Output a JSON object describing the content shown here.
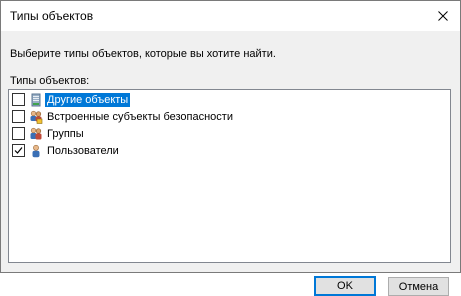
{
  "window": {
    "title": "Типы объектов",
    "close_icon": "close-icon"
  },
  "instruction": "Выберите типы объектов, которые вы хотите найти.",
  "list_label": "Типы объектов:",
  "object_types": [
    {
      "label": "Другие объекты",
      "checked": false,
      "selected": true,
      "icon": "other-objects-icon"
    },
    {
      "label": "Встроенные субъекты безопасности",
      "checked": false,
      "selected": false,
      "icon": "security-principals-icon"
    },
    {
      "label": "Группы",
      "checked": false,
      "selected": false,
      "icon": "groups-icon"
    },
    {
      "label": "Пользователи",
      "checked": true,
      "selected": false,
      "icon": "user-icon"
    }
  ],
  "buttons": {
    "ok": "OK",
    "cancel": "Отмена"
  },
  "colors": {
    "accent": "#0078d7",
    "dialog_bg": "#f0f0f0"
  }
}
